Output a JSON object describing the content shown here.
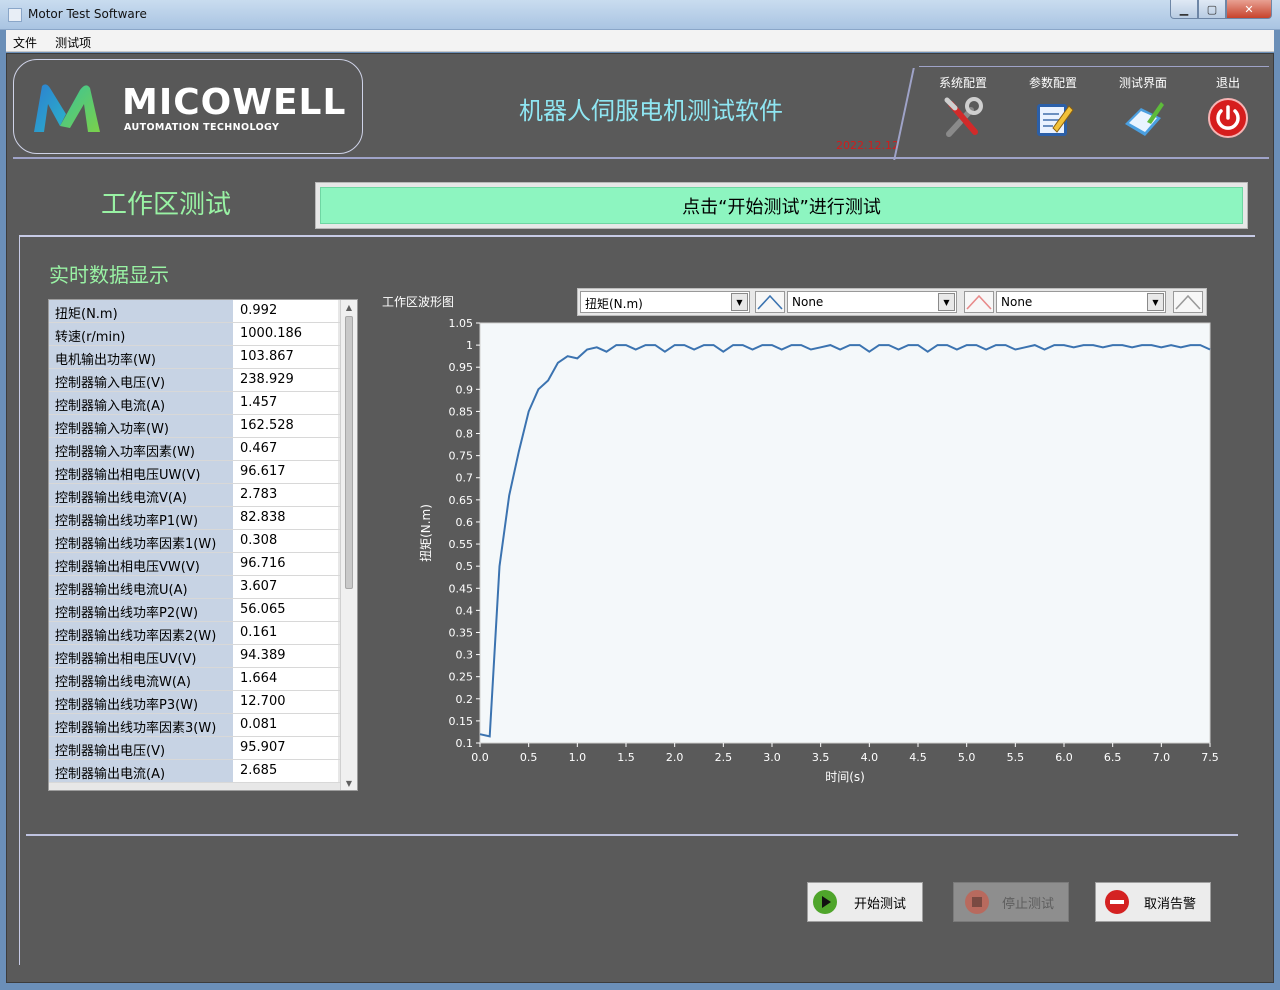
{
  "window": {
    "title": "Motor Test Software"
  },
  "menu": [
    "文件",
    "测试项"
  ],
  "header": {
    "logo_text": "MICOWELL",
    "logo_sub": "AUTOMATION TECHNOLOGY",
    "app_title": "机器人伺服电机测试软件",
    "date": "2022.12.12",
    "tools": [
      {
        "label": "系统配置",
        "icon": "tools-icon"
      },
      {
        "label": "参数配置",
        "icon": "notepad-icon"
      },
      {
        "label": "测试界面",
        "icon": "clipboard-icon"
      },
      {
        "label": "退出",
        "icon": "power-icon"
      }
    ]
  },
  "section": {
    "title": "工作区测试",
    "status": "点击“开始测试”进行测试"
  },
  "panel": {
    "title": "实时数据显示"
  },
  "table": [
    {
      "name": "扭矩(N.m)",
      "value": "0.992"
    },
    {
      "name": "转速(r/min)",
      "value": "1000.186"
    },
    {
      "name": "电机输出功率(W)",
      "value": "103.867"
    },
    {
      "name": "控制器输入电压(V)",
      "value": "238.929"
    },
    {
      "name": "控制器输入电流(A)",
      "value": "1.457"
    },
    {
      "name": "控制器输入功率(W)",
      "value": "162.528"
    },
    {
      "name": "控制器输入功率因素(W)",
      "value": "0.467"
    },
    {
      "name": "控制器输出相电压UW(V)",
      "value": "96.617"
    },
    {
      "name": "控制器输出线电流V(A)",
      "value": "2.783"
    },
    {
      "name": "控制器输出线功率P1(W)",
      "value": "82.838"
    },
    {
      "name": "控制器输出线功率因素1(W)",
      "value": "0.308"
    },
    {
      "name": "控制器输出相电压VW(V)",
      "value": "96.716"
    },
    {
      "name": "控制器输出线电流U(A)",
      "value": "3.607"
    },
    {
      "name": "控制器输出线功率P2(W)",
      "value": "56.065"
    },
    {
      "name": "控制器输出线功率因素2(W)",
      "value": "0.161"
    },
    {
      "name": "控制器输出相电压UV(V)",
      "value": "94.389"
    },
    {
      "name": "控制器输出线电流W(A)",
      "value": "1.664"
    },
    {
      "name": "控制器输出线功率P3(W)",
      "value": "12.700"
    },
    {
      "name": "控制器输出线功率因素3(W)",
      "value": "0.081"
    },
    {
      "name": "控制器输出电压(V)",
      "value": "95.907"
    },
    {
      "name": "控制器输出电流(A)",
      "value": "2.685"
    }
  ],
  "chart_controls": {
    "label": "工作区波形图",
    "select1": "扭矩(N.m)",
    "select2": "None",
    "select3": "None",
    "swatch_colors": [
      "#3b73b0",
      "#e88a8a",
      "#9a9a9a"
    ]
  },
  "chart_data": {
    "type": "line",
    "xlabel": "时间(s)",
    "ylabel": "扭矩(N.m)",
    "xlim": [
      0,
      7.5
    ],
    "ylim": [
      0.1,
      1.05
    ],
    "xticks": [
      "0.0",
      "0.5",
      "1.0",
      "1.5",
      "2.0",
      "2.5",
      "3.0",
      "3.5",
      "4.0",
      "4.5",
      "5.0",
      "5.5",
      "6.0",
      "6.5",
      "7.0",
      "7.5"
    ],
    "yticks": [
      "0.1",
      "0.15",
      "0.2",
      "0.25",
      "0.3",
      "0.35",
      "0.4",
      "0.45",
      "0.5",
      "0.55",
      "0.6",
      "0.65",
      "0.7",
      "0.75",
      "0.8",
      "0.85",
      "0.9",
      "0.95",
      "1",
      "1.05"
    ],
    "grid": false,
    "color": "#3b73b0",
    "series": [
      {
        "x": [
          0.0,
          0.1,
          0.2,
          0.3,
          0.4,
          0.5,
          0.6,
          0.7,
          0.8,
          0.9,
          1.0,
          1.1,
          1.2,
          1.3,
          1.4,
          1.5,
          1.6,
          1.7,
          1.8,
          1.9,
          2.0,
          2.1,
          2.2,
          2.3,
          2.4,
          2.5,
          2.6,
          2.7,
          2.8,
          2.9,
          3.0,
          3.1,
          3.2,
          3.3,
          3.4,
          3.5,
          3.6,
          3.7,
          3.8,
          3.9,
          4.0,
          4.1,
          4.2,
          4.3,
          4.4,
          4.5,
          4.6,
          4.7,
          4.8,
          4.9,
          5.0,
          5.1,
          5.2,
          5.3,
          5.4,
          5.5,
          5.6,
          5.7,
          5.8,
          5.9,
          6.0,
          6.1,
          6.2,
          6.3,
          6.4,
          6.5,
          6.6,
          6.7,
          6.8,
          6.9,
          7.0,
          7.1,
          7.2,
          7.3,
          7.4,
          7.5
        ],
        "y": [
          0.12,
          0.115,
          0.5,
          0.66,
          0.76,
          0.85,
          0.9,
          0.92,
          0.96,
          0.975,
          0.97,
          0.99,
          0.995,
          0.985,
          1.0,
          1.0,
          0.99,
          1.0,
          1.0,
          0.985,
          1.0,
          1.0,
          0.99,
          1.0,
          1.0,
          0.985,
          1.0,
          1.0,
          0.99,
          1.0,
          1.0,
          0.99,
          1.0,
          1.0,
          0.99,
          0.995,
          1.0,
          0.99,
          1.0,
          1.0,
          0.985,
          1.0,
          1.0,
          0.99,
          1.0,
          1.0,
          0.985,
          1.0,
          1.0,
          0.99,
          1.0,
          1.0,
          0.99,
          1.0,
          1.0,
          0.99,
          0.995,
          1.0,
          0.99,
          1.0,
          1.0,
          0.995,
          1.0,
          1.0,
          0.995,
          1.0,
          1.0,
          0.995,
          1.0,
          1.0,
          0.995,
          1.0,
          0.995,
          1.0,
          1.0,
          0.99
        ]
      }
    ]
  },
  "buttons": {
    "start": "开始测试",
    "stop": "停止测试",
    "cancel": "取消告警"
  }
}
